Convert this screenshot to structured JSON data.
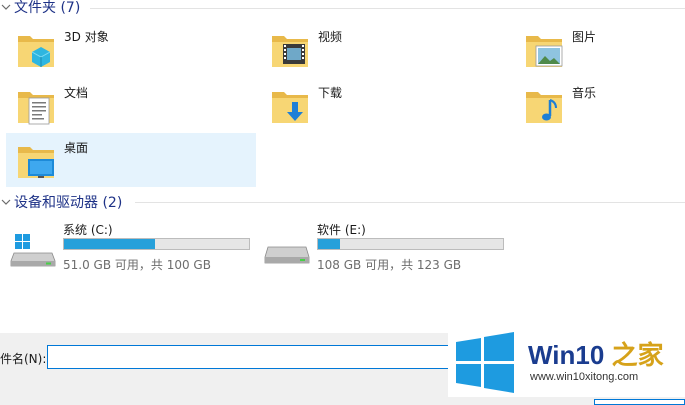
{
  "folders_section": {
    "title": "文件夹 (7)"
  },
  "folders": [
    {
      "label": "3D 对象",
      "icon": "3d-objects-folder-icon"
    },
    {
      "label": "视频",
      "icon": "videos-folder-icon"
    },
    {
      "label": "图片",
      "icon": "pictures-folder-icon"
    },
    {
      "label": "文档",
      "icon": "documents-folder-icon"
    },
    {
      "label": "下载",
      "icon": "downloads-folder-icon"
    },
    {
      "label": "音乐",
      "icon": "music-folder-icon"
    },
    {
      "label": "桌面",
      "icon": "desktop-folder-icon"
    }
  ],
  "drives_section": {
    "title": "设备和驱动器 (2)"
  },
  "drives": [
    {
      "name": "系统 (C:)",
      "free": "51.0 GB 可用，共 100 GB",
      "used_fraction": 0.49
    },
    {
      "name": "软件 (E:)",
      "free": "108 GB 可用，共 123 GB",
      "used_fraction": 0.12
    }
  ],
  "filename": {
    "label": "件名(N):",
    "value": ""
  },
  "watermark": {
    "title_main": "Win10 ",
    "title_accent": "之家",
    "url": "www.win10xitong.com"
  },
  "colors": {
    "accent": "#0078d7",
    "bar_fill": "#26a0da",
    "section_title": "#1e3287",
    "selected_bg": "#e5f3fd"
  }
}
